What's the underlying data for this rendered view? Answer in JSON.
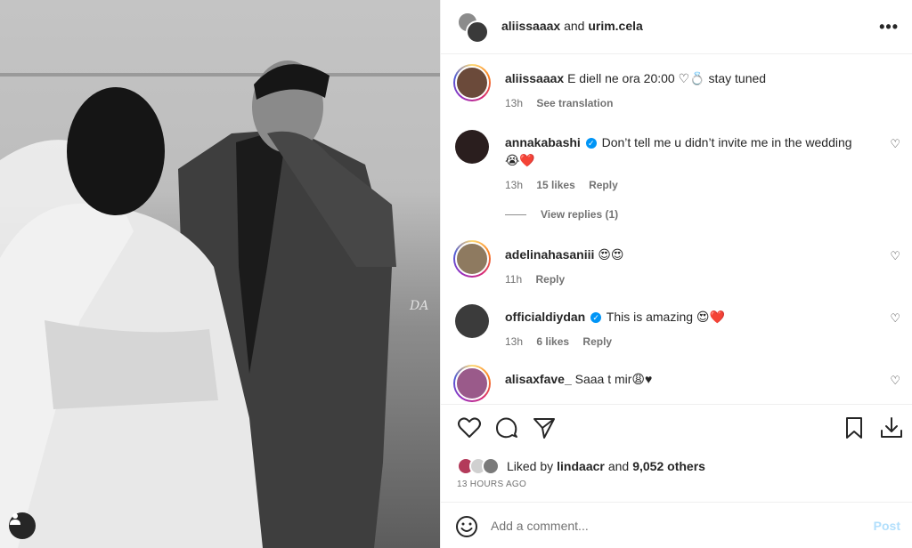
{
  "header": {
    "user1": "aliissaaax",
    "joiner": "and",
    "user2": "urim.cela",
    "more": "•••"
  },
  "photo": {
    "watermark": "DA"
  },
  "caption": {
    "username": "aliissaaax",
    "text": "E diell ne ora 20:00 ♡💍 stay tuned",
    "time": "13h",
    "translate": "See translation"
  },
  "comments": [
    {
      "username": "annakabashi",
      "verified": true,
      "text": "Don’t tell me u didn’t invite me in the wedding 😭❤️",
      "time": "13h",
      "likes": "15 likes",
      "reply": "Reply"
    },
    {
      "username": "adelinahasaniii",
      "verified": false,
      "text": "😍😍",
      "time": "11h",
      "likes": "",
      "reply": "Reply"
    },
    {
      "username": "officialdiydan",
      "verified": true,
      "text": "This is amazing 😍❤️",
      "time": "13h",
      "likes": "6 likes",
      "reply": "Reply"
    },
    {
      "username": "alisaxfave_",
      "verified": false,
      "text": "Saaa t mir😩♥",
      "time": "",
      "likes": "",
      "reply": ""
    }
  ],
  "view_replies": "View replies (1)",
  "likes": {
    "prefix": "Liked by",
    "user": "lindaacr",
    "joiner": "and",
    "count": "9,052 others"
  },
  "timestamp": "13 HOURS AGO",
  "add_comment": {
    "placeholder": "Add a comment...",
    "post": "Post"
  },
  "icons": [
    "heart-icon",
    "comment-icon",
    "share-icon",
    "bookmark-icon",
    "download-icon",
    "emoji-icon",
    "more-icon",
    "user-tag-icon"
  ]
}
